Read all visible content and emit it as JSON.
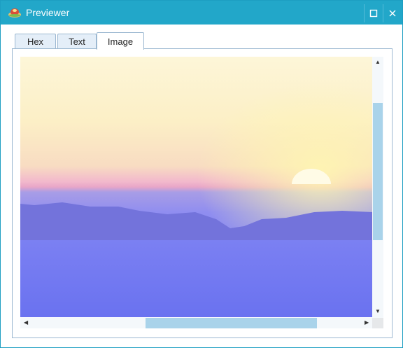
{
  "window": {
    "title": "Previewer",
    "app_icon": "previewer-app-icon",
    "maximize_icon": "maximize-icon",
    "close_icon": "close-icon",
    "accent_color": "#22a7c9"
  },
  "tabs": [
    {
      "label": "Hex",
      "selected": false
    },
    {
      "label": "Text",
      "selected": false
    },
    {
      "label": "Image",
      "selected": true
    }
  ],
  "preview": {
    "icon_up": "scroll-up-arrow-icon",
    "icon_down": "scroll-down-arrow-icon",
    "icon_left": "scroll-left-arrow-icon",
    "icon_right": "scroll-right-arrow-icon"
  }
}
